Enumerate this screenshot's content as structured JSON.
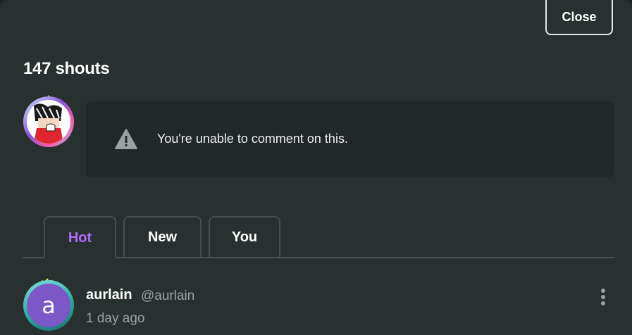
{
  "header": {
    "close_label": "Close"
  },
  "shouts": {
    "title": "147 shouts"
  },
  "notice": {
    "icon": "warning-icon",
    "message": "You're unable to comment on this."
  },
  "tabs": [
    {
      "label": "Hot",
      "active": true
    },
    {
      "label": "New",
      "active": false
    },
    {
      "label": "You",
      "active": false
    }
  ],
  "comments": [
    {
      "name": "aurlain",
      "handle": "@aurlain",
      "time": "1 day ago",
      "avatar_letter": "a"
    }
  ],
  "colors": {
    "background": "#293030",
    "notice_bg": "#222828",
    "active_tab": "#b36bff",
    "muted_text": "#9aa2a2",
    "avatar_purple": "#7b57c8"
  }
}
